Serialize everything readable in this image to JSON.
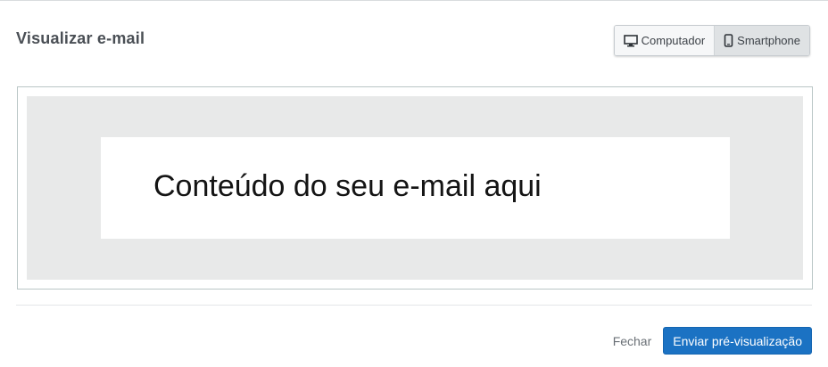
{
  "header": {
    "title": "Visualizar e-mail",
    "view_toggle": {
      "desktop_label": "Computador",
      "desktop_icon": "monitor-icon",
      "mobile_label": "Smartphone",
      "mobile_icon": "smartphone-icon",
      "selected": "Smartphone"
    }
  },
  "preview": {
    "content_text": "Conteúdo do seu e-mail aqui"
  },
  "footer": {
    "close_label": "Fechar",
    "send_label": "Enviar pré-visualização"
  },
  "colors": {
    "primary_button": "#1b72c3",
    "preview_background": "#e8e9e9",
    "frame_border": "#b9c6c6"
  }
}
